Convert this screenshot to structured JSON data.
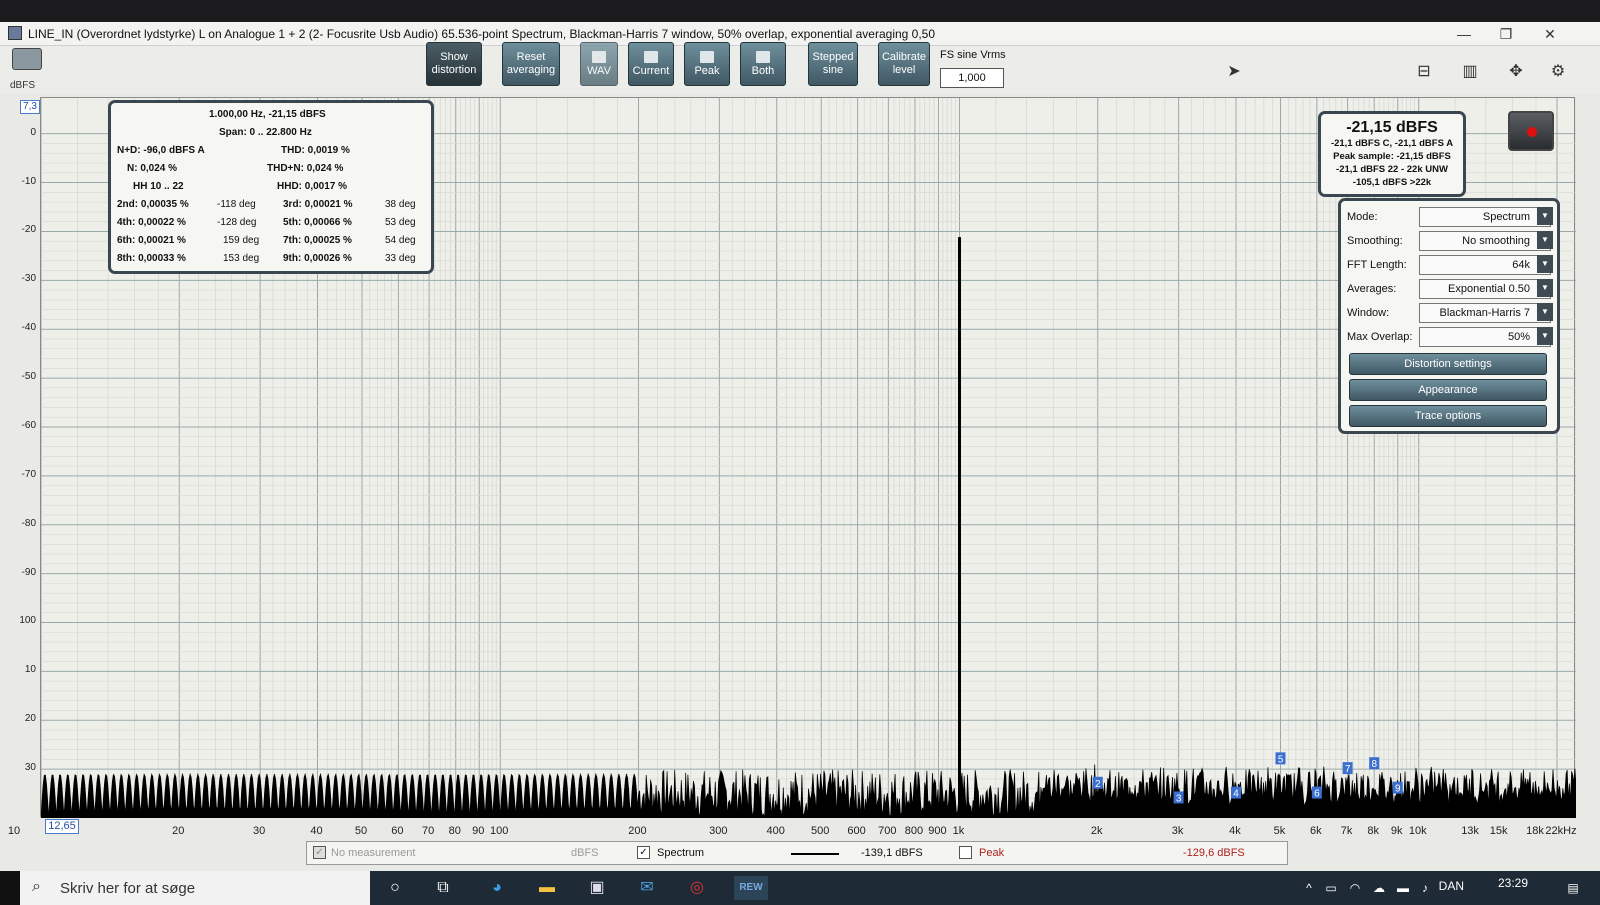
{
  "window": {
    "title": "LINE_IN (Overordnet lydstyrke) L on Analogue 1 + 2 (2- Focusrite Usb Audio) 65.536-point Spectrum, Blackman-Harris 7 window, 50% overlap, exponential averaging 0,50",
    "minimize": "—",
    "restore": "❐",
    "close": "✕"
  },
  "toolbar": {
    "show_distortion": "Show distortion",
    "reset_averaging": "Reset averaging",
    "wav": "WAV",
    "current": "Current",
    "peak": "Peak",
    "both": "Both",
    "stepped_sine": "Stepped sine",
    "calibrate_level": "Calibrate level",
    "fs_sine_label": "FS sine Vrms",
    "fs_sine_value": "1,000"
  },
  "graph": {
    "y_unit": "dBFS",
    "y_top_value": "7,3",
    "x_left_value": "12,65"
  },
  "distortion_panel": {
    "header": "1.000,00 Hz, -21,15 dBFS",
    "span": "Span: 0 .. 22.800 Hz",
    "nd": "N+D: -96,0 dBFS A",
    "thd": "THD: 0,0019 %",
    "n": "N: 0,024 %",
    "thdn": "THD+N: 0,024 %",
    "hh": "HH 10 .. 22",
    "hhd": "HHD: 0,0017 %",
    "h2": "2nd: 0,00035 %",
    "h2deg": "-118 deg",
    "h3": "3rd: 0,00021 %",
    "h3deg": "38 deg",
    "h4": "4th: 0,00022 %",
    "h4deg": "-128 deg",
    "h5": "5th: 0,00066 %",
    "h5deg": "53 deg",
    "h6": "6th: 0,00021 %",
    "h6deg": "159 deg",
    "h7": "7th: 0,00025 %",
    "h7deg": "54 deg",
    "h8": "8th: 0,00033 %",
    "h8deg": "153 deg",
    "h9": "9th: 0,00026 %",
    "h9deg": "33 deg"
  },
  "level_panel": {
    "main": "-21,15 dBFS",
    "l1": "-21,1 dBFS C, -21,1 dBFS A",
    "l2": "Peak sample: -21,15 dBFS",
    "l3": "-21,1 dBFS 22 - 22k UNW",
    "l4": "-105,1 dBFS >22k"
  },
  "controls": {
    "mode_label": "Mode:",
    "mode_value": "Spectrum",
    "smoothing_label": "Smoothing:",
    "smoothing_value": "No smoothing",
    "fft_label": "FFT Length:",
    "fft_value": "64k",
    "averages_label": "Averages:",
    "averages_value": "Exponential 0.50",
    "window_label": "Window:",
    "window_value": "Blackman-Harris 7",
    "overlap_label": "Max Overlap:",
    "overlap_value": "50%",
    "distortion_settings": "Distortion settings",
    "appearance": "Appearance",
    "trace_options": "Trace options"
  },
  "legend": {
    "no_measurement": "No measurement",
    "no_measurement_unit": "dBFS",
    "spectrum": "Spectrum",
    "spectrum_value": "-139,1 dBFS",
    "peak": "Peak",
    "peak_value": "-129,6 dBFS"
  },
  "taskbar": {
    "search_placeholder": "Skriv her for at søge",
    "rew": "REW",
    "language": "DAN",
    "time": "23:29"
  },
  "chart_data": {
    "type": "line",
    "ylabel": "dBFS",
    "x_scale": "log",
    "xlim": [
      10,
      22000
    ],
    "ylim": [
      -140,
      7.3
    ],
    "y_ticks": [
      0,
      -10,
      -20,
      -30,
      -40,
      -50,
      -60,
      -70,
      -80,
      -90,
      -100,
      -110,
      -120,
      -130
    ],
    "y_tick_labels": [
      "0",
      "-10",
      "-20",
      "-30",
      "-40",
      "-50",
      "-60",
      "-70",
      "-80",
      "-90",
      "100",
      "10",
      "20",
      "30"
    ],
    "x_ticks": [
      10,
      20,
      30,
      40,
      50,
      60,
      70,
      80,
      90,
      100,
      200,
      300,
      400,
      500,
      600,
      700,
      800,
      900,
      1000,
      2000,
      3000,
      4000,
      5000,
      6000,
      7000,
      8000,
      9000,
      10000,
      13000,
      15000,
      18000,
      22000
    ],
    "x_tick_labels": [
      "10",
      "20",
      "30",
      "40",
      "50",
      "60",
      "70",
      "80",
      "90",
      "100",
      "200",
      "300",
      "400",
      "500",
      "600",
      "700",
      "800",
      "900",
      "1k",
      "2k",
      "3k",
      "4k",
      "5k",
      "6k",
      "7k",
      "8k",
      "9k",
      "10k",
      "13k",
      "15k",
      "18k",
      "22kHz"
    ],
    "peak": {
      "frequency_hz": 1000,
      "level_dbfs": -21.15
    },
    "noise_floor_dbfs": -130,
    "harmonic_markers": [
      {
        "label": "2",
        "x": 2000,
        "y": -133
      },
      {
        "label": "3",
        "x": 3000,
        "y": -136
      },
      {
        "label": "4",
        "x": 4000,
        "y": -135
      },
      {
        "label": "5",
        "x": 5000,
        "y": -128
      },
      {
        "label": "6",
        "x": 6000,
        "y": -135
      },
      {
        "label": "7",
        "x": 7000,
        "y": -130
      },
      {
        "label": "8",
        "x": 8000,
        "y": -129
      },
      {
        "label": "9",
        "x": 9000,
        "y": -134
      }
    ],
    "series": [
      {
        "name": "Spectrum"
      }
    ]
  }
}
